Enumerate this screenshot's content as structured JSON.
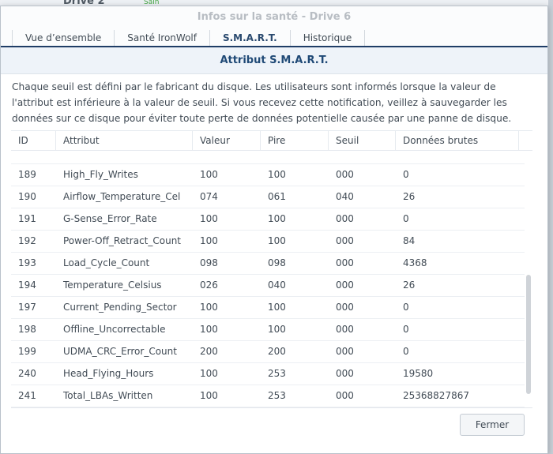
{
  "background_window": {
    "title_fragment": "Drive 2",
    "status_fragment": "Sain"
  },
  "dialog": {
    "title": "Infos sur la santé - Drive 6",
    "tabs": [
      {
        "label": "Vue d’ensemble",
        "active": false
      },
      {
        "label": "Santé IronWolf",
        "active": false
      },
      {
        "label": "S.M.A.R.T.",
        "active": true
      },
      {
        "label": "Historique",
        "active": false
      }
    ],
    "section_title": "Attribut S.M.A.R.T.",
    "description": "Chaque seuil est défini par le fabricant du disque. Les utilisateurs sont informés lorsque la valeur de l'attribut est inférieure à la valeur de seuil. Si vous recevez cette notification, veillez à sauvegarder les données sur ce disque pour éviter toute perte de données potentielle causée par une panne de disque.",
    "table": {
      "columns": [
        "ID",
        "Attribut",
        "Valeur",
        "Pire",
        "Seuil",
        "Données brutes"
      ],
      "rows": [
        [
          "189",
          "High_Fly_Writes",
          "100",
          "100",
          "000",
          "0"
        ],
        [
          "190",
          "Airflow_Temperature_Cel",
          "074",
          "061",
          "040",
          "26"
        ],
        [
          "191",
          "G-Sense_Error_Rate",
          "100",
          "100",
          "000",
          "0"
        ],
        [
          "192",
          "Power-Off_Retract_Count",
          "100",
          "100",
          "000",
          "84"
        ],
        [
          "193",
          "Load_Cycle_Count",
          "098",
          "098",
          "000",
          "4368"
        ],
        [
          "194",
          "Temperature_Celsius",
          "026",
          "040",
          "000",
          "26"
        ],
        [
          "197",
          "Current_Pending_Sector",
          "100",
          "100",
          "000",
          "0"
        ],
        [
          "198",
          "Offline_Uncorrectable",
          "100",
          "100",
          "000",
          "0"
        ],
        [
          "199",
          "UDMA_CRC_Error_Count",
          "200",
          "200",
          "000",
          "0"
        ],
        [
          "240",
          "Head_Flying_Hours",
          "100",
          "253",
          "000",
          "19580"
        ],
        [
          "241",
          "Total_LBAs_Written",
          "100",
          "253",
          "000",
          "25368827867"
        ]
      ]
    },
    "close_button": "Fermer"
  }
}
